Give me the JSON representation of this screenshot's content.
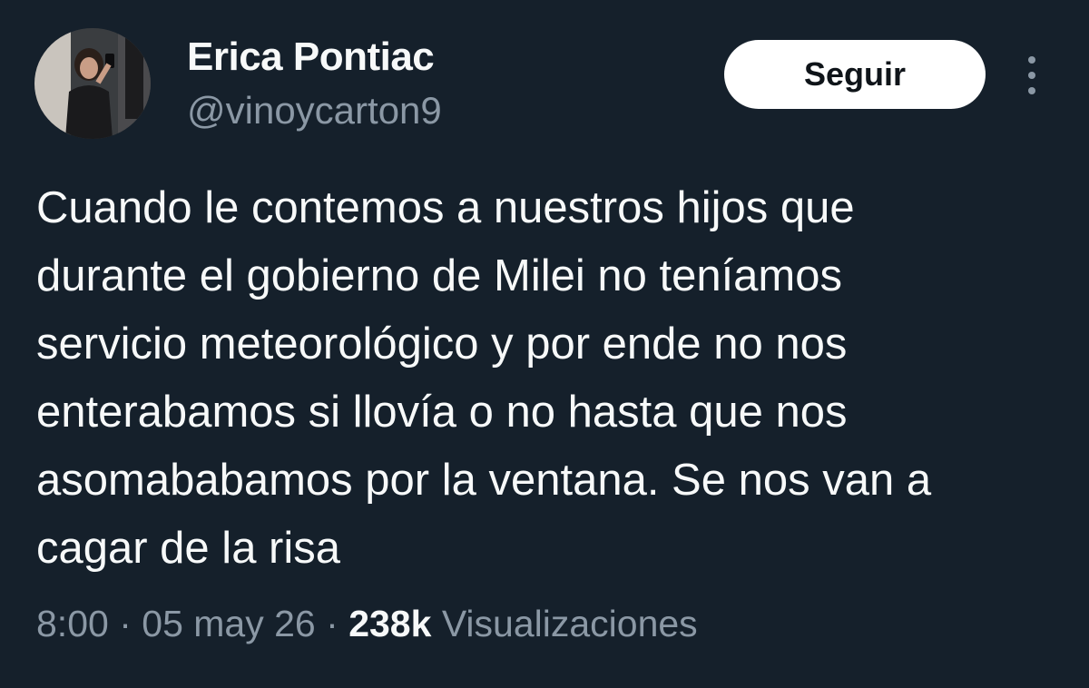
{
  "author": {
    "display_name": "Erica Pontiac",
    "handle": "@vinoycarton9",
    "avatar_icon": "profile-photo"
  },
  "actions": {
    "follow_label": "Seguir",
    "more_icon": "more-options-vertical-dots"
  },
  "tweet": {
    "lines": [
      "Cuando le contemos a nuestros hijos que",
      "durante el gobierno de Milei no teníamos",
      "servicio meteorológico y por ende no nos",
      "enterabamos si llovía o no hasta que nos",
      "asomababamos por la ventana. Se nos van a",
      "cagar de la risa"
    ]
  },
  "meta": {
    "time": "8:00",
    "separator": "·",
    "date": "05 may 26",
    "views_count": "238k",
    "views_label": "Visualizaciones"
  },
  "colors": {
    "background": "#15202b",
    "primary_text": "#f7f9f9",
    "secondary_text": "#8b98a5",
    "button_bg": "#ffffff",
    "button_text": "#0f1419"
  }
}
